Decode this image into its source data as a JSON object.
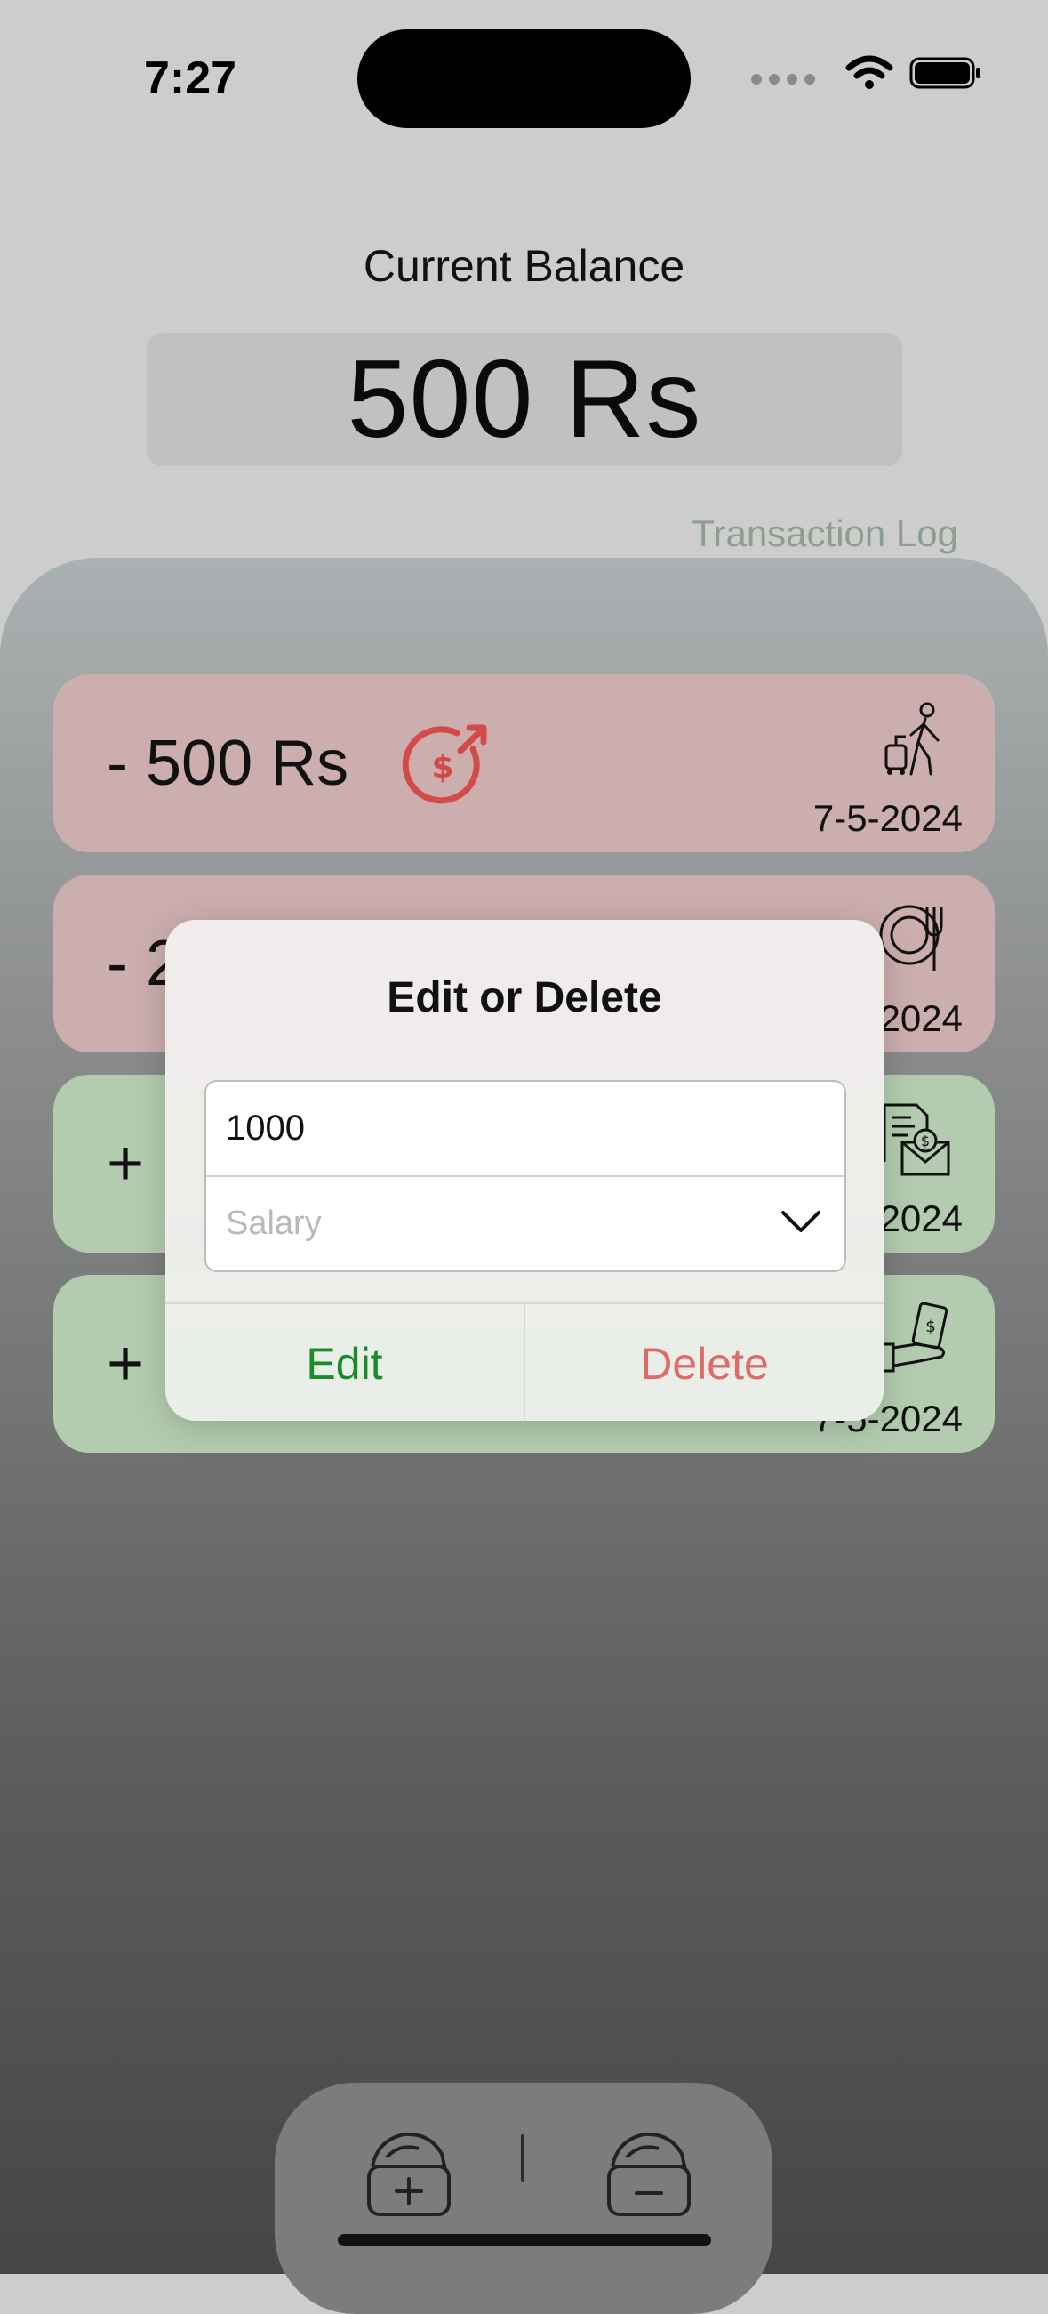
{
  "status_bar": {
    "time": "7:27"
  },
  "header": {
    "balance_label": "Current Balance",
    "balance_value": "500 Rs",
    "log_link": "Transaction Log"
  },
  "transactions": [
    {
      "amount": "- 500 Rs",
      "date": "7-5-2024",
      "kind": "expense",
      "type_icon": "send-money-icon",
      "category_icon": "travel-icon"
    },
    {
      "amount": "- 2",
      "date": "2024",
      "kind": "expense",
      "category_icon": "dining-icon"
    },
    {
      "amount": "+",
      "date": "2024",
      "kind": "income",
      "category_icon": "salary-envelope-icon"
    },
    {
      "amount": "+",
      "date": "7-5-2024",
      "kind": "income",
      "category_icon": "cash-in-hand-icon"
    }
  ],
  "dialog": {
    "title": "Edit or Delete",
    "amount_value": "1000",
    "category_placeholder": "Salary",
    "edit_label": "Edit",
    "delete_label": "Delete"
  },
  "bottom_bar": {
    "add_icon": "wallet-add-icon",
    "remove_icon": "wallet-remove-icon"
  },
  "colors": {
    "expense": "#ccaeae",
    "income": "#b3ccaf",
    "edit": "#1c8a2a",
    "delete": "#e06a6a",
    "accent_red": "#d24a4a"
  }
}
